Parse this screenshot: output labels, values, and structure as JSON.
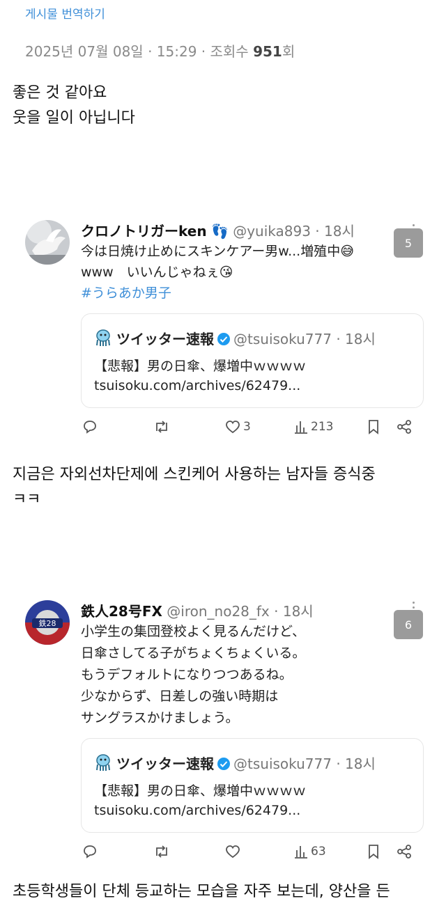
{
  "header": {
    "translate_link": "게시물 번역하기",
    "meta_prefix": "2025년 07월 08일 · 15:29 · 조회수 ",
    "view_count": "951",
    "meta_suffix": "회"
  },
  "post_body": [
    "좋은 것 같아요",
    "웃을 일이 아닙니다"
  ],
  "tweets": [
    {
      "name": "クロノトリガーken",
      "name_emoji": "👣",
      "handle": "@yuika893 · 18시",
      "lines": [
        "今は日焼け止めにスキンケアー男w...増殖中😅",
        "www　いいんじゃねぇ😘"
      ],
      "hashtag": "#うらあか男子",
      "badge": "5",
      "quote": {
        "name": "ツイッター速報",
        "handle": "@tsuisoku777 · 18시",
        "line1": "【悲報】男の日傘、爆増中ｗｗｗｗ",
        "line2": "tsuisoku.com/archives/62479..."
      },
      "actions": {
        "reply": "",
        "retweet": "",
        "like": "3",
        "views": "213"
      }
    },
    {
      "name": "鉄人28号FX",
      "handle": "@iron_no28_fx · 18시",
      "lines": [
        "小学生の集団登校よく見るんだけど、",
        "日傘さしてる子がちょくちょくいる。",
        "もうデフォルトになりつつあるね。",
        "少なからず、日差しの強い時期は",
        "サングラスかけましょう。"
      ],
      "badge": "6",
      "quote": {
        "name": "ツイッター速報",
        "handle": "@tsuisoku777 · 18시",
        "line1": "【悲報】男の日傘、爆増中ｗｗｗｗ",
        "line2": "tsuisoku.com/archives/62479..."
      },
      "actions": {
        "reply": "",
        "retweet": "",
        "like": "",
        "views": "63"
      }
    }
  ],
  "middle_text": [
    "지금은 자외선차단제에 스킨케어 사용하는 남자들 증식중",
    "ㅋㅋ"
  ],
  "bottom_text": "초등학생들이 단체 등교하는 모습을 자주 보는데, 양산을 든",
  "colors": {
    "link": "#3f8fd8",
    "badge": "#9b9b9b",
    "verified": "#1d9bf0"
  }
}
